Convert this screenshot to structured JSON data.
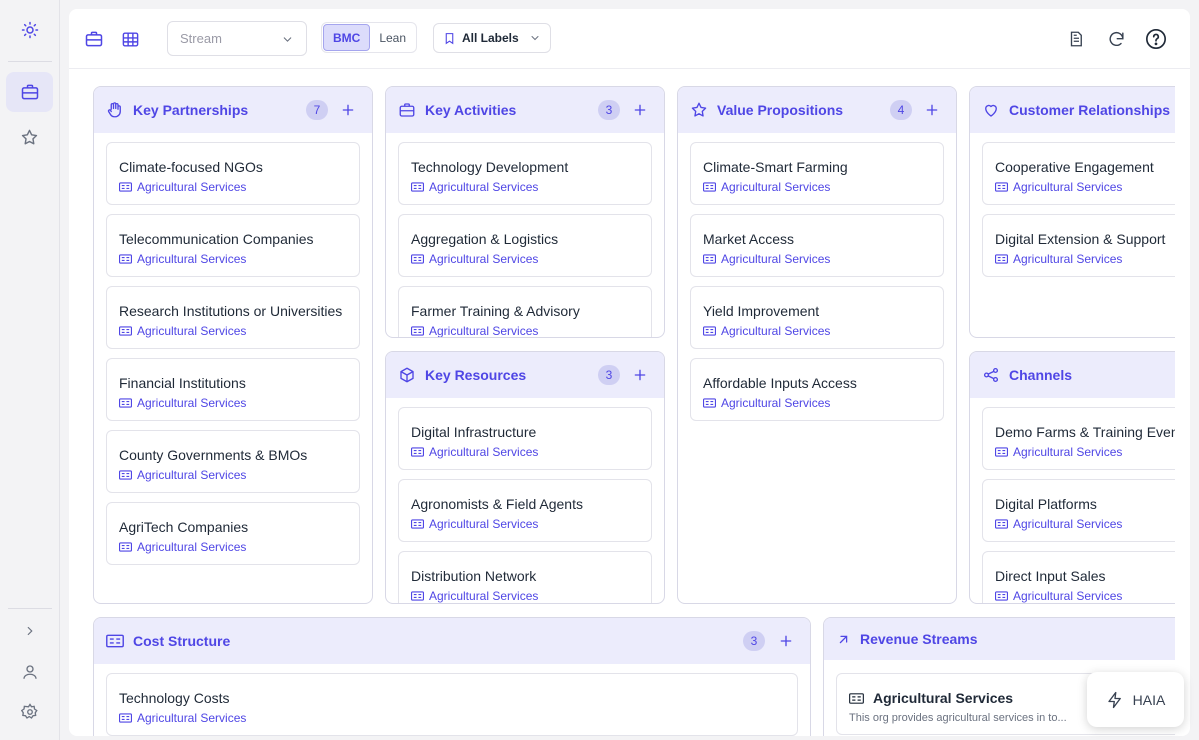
{
  "toolbar": {
    "stream_placeholder": "Stream",
    "segment": [
      "BMC",
      "Lean"
    ],
    "labels_filter": "All Labels"
  },
  "blocks": {
    "partnerships": {
      "title": "Key Partnerships",
      "count": "7",
      "cards": [
        {
          "title": "Climate-focused NGOs",
          "tag": "Agricultural Services"
        },
        {
          "title": "Telecommunication Companies",
          "tag": "Agricultural Services"
        },
        {
          "title": "Research Institutions or Universities",
          "tag": "Agricultural Services"
        },
        {
          "title": "Financial Institutions",
          "tag": "Agricultural Services"
        },
        {
          "title": "County Governments & BMOs",
          "tag": "Agricultural Services"
        },
        {
          "title": "AgriTech Companies",
          "tag": "Agricultural Services"
        }
      ]
    },
    "activities": {
      "title": "Key Activities",
      "count": "3",
      "cards": [
        {
          "title": "Technology Development",
          "tag": "Agricultural Services"
        },
        {
          "title": "Aggregation & Logistics",
          "tag": "Agricultural Services"
        },
        {
          "title": "Farmer Training & Advisory",
          "tag": "Agricultural Services"
        }
      ]
    },
    "resources": {
      "title": "Key Resources",
      "count": "3",
      "cards": [
        {
          "title": "Digital Infrastructure",
          "tag": "Agricultural Services"
        },
        {
          "title": "Agronomists & Field Agents",
          "tag": "Agricultural Services"
        },
        {
          "title": "Distribution Network",
          "tag": "Agricultural Services"
        }
      ]
    },
    "value": {
      "title": "Value Propositions",
      "count": "4",
      "cards": [
        {
          "title": "Climate-Smart Farming",
          "tag": "Agricultural Services"
        },
        {
          "title": "Market Access",
          "tag": "Agricultural Services"
        },
        {
          "title": "Yield Improvement",
          "tag": "Agricultural Services"
        },
        {
          "title": "Affordable Inputs Access",
          "tag": "Agricultural Services"
        }
      ]
    },
    "relationships": {
      "title": "Customer Relationships",
      "cards": [
        {
          "title": "Cooperative Engagement",
          "tag": "Agricultural Services"
        },
        {
          "title": "Digital Extension & Support",
          "tag": "Agricultural Services"
        }
      ]
    },
    "channels": {
      "title": "Channels",
      "cards": [
        {
          "title": "Demo Farms & Training Events",
          "tag": "Agricultural Services"
        },
        {
          "title": "Digital Platforms",
          "tag": "Agricultural Services"
        },
        {
          "title": "Direct Input Sales",
          "tag": "Agricultural Services"
        }
      ]
    },
    "cost": {
      "title": "Cost Structure",
      "count": "3",
      "cards": [
        {
          "title": "Technology Costs",
          "tag": "Agricultural Services"
        }
      ]
    },
    "revenue": {
      "title": "Revenue Streams",
      "cards": [
        {
          "title": "Agricultural Services",
          "desc": "This org provides agricultural services in to..."
        }
      ]
    }
  },
  "assistant": {
    "label": "HAIA"
  },
  "colors": {
    "accent": "#4f46e5",
    "header_bg": "#ececfc",
    "badge_bg": "#cfcff3"
  }
}
